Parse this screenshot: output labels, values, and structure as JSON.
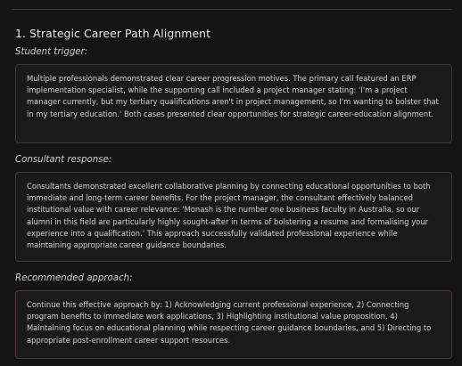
{
  "section": {
    "title": "1. Strategic Career Path Alignment",
    "student_trigger_label": "Student trigger:",
    "student_trigger_text": "Multiple professionals demonstrated clear career progression motives. The primary call featured an ERP implementation specialist, while the supporting call included a project manager stating: 'I'm a project manager currently, but my tertiary qualifications aren't in project management, so I'm wanting to bolster that in my tertiary education.' Both cases presented clear opportunities for strategic career-education alignment.",
    "consultant_response_label": "Consultant response:",
    "consultant_response_text": "Consultants demonstrated excellent collaborative planning by connecting educational opportunities to both immediate and long-term career benefits. For the project manager, the consultant effectively balanced institutional value with career relevance: 'Monash is the number one business faculty in Australia, so our alumni in this field are particularly highly sought-after in terms of bolstering a resume and formalising your experience into a qualification.' This approach successfully validated professional experience while maintaining appropriate career guidance boundaries.",
    "recommended_approach_label": "Recommended approach:",
    "recommended_approach_text": "Continue this effective approach by: 1) Acknowledging current professional experience, 2) Connecting program benefits to immediate work applications, 3) Highlighting institutional value proposition, 4) Maintaining focus on educational planning while respecting career guidance boundaries, and 5) Directing to appropriate post-enrollment career support resources."
  },
  "colors": {
    "background": "#141414",
    "card_border": "#3b3b3b",
    "recommended_border": "#5a3535",
    "text": "#d2d2d2"
  }
}
